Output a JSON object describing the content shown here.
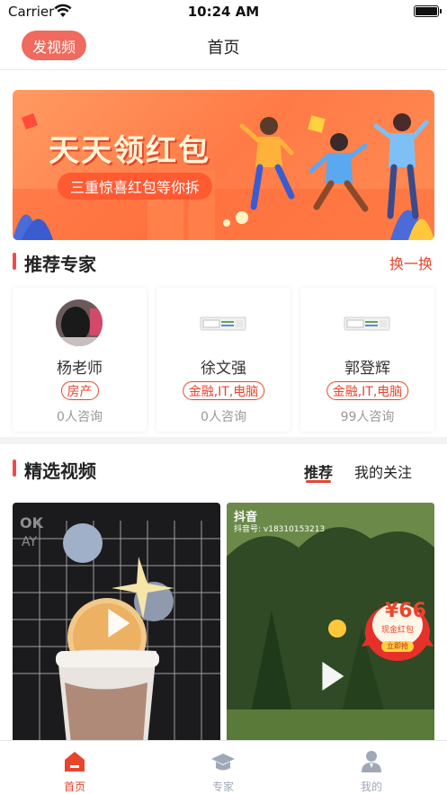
{
  "status_bar": {
    "carrier": "Carrier",
    "time": "10:24 AM"
  },
  "nav": {
    "post_video": "发视频",
    "title": "首页"
  },
  "banner": {
    "title": "天天领红包",
    "subtitle": "三重惊喜红包等你拆"
  },
  "experts_section": {
    "title": "推荐专家",
    "change_label": "换一换",
    "items": [
      {
        "name": "杨老师",
        "tag": "房产",
        "count": "0人咨询"
      },
      {
        "name": "徐文强",
        "tag": "金融,IT,电脑",
        "count": "0人咨询"
      },
      {
        "name": "郭登辉",
        "tag": "金融,IT,电脑",
        "count": "99人咨询"
      }
    ]
  },
  "videos_section": {
    "title": "精选视频",
    "tabs": [
      {
        "label": "推荐",
        "active": true
      },
      {
        "label": "我的关注",
        "active": false
      }
    ],
    "videos": [
      {
        "source": "",
        "account": ""
      },
      {
        "source": "抖音",
        "account": "抖音号: v18310153213",
        "redpack_amount": "¥66",
        "redpack_label": "现金红包",
        "redpack_button": "立即抢"
      }
    ]
  },
  "tab_bar": {
    "items": [
      {
        "label": "首页",
        "icon": "home-icon",
        "active": true
      },
      {
        "label": "专家",
        "icon": "graduation-cap-icon",
        "active": false
      },
      {
        "label": "我的",
        "icon": "user-icon",
        "active": false
      }
    ],
    "active_color": "#e8452c",
    "inactive_color": "#a0a8b8"
  },
  "accent_color": "#e8452c"
}
